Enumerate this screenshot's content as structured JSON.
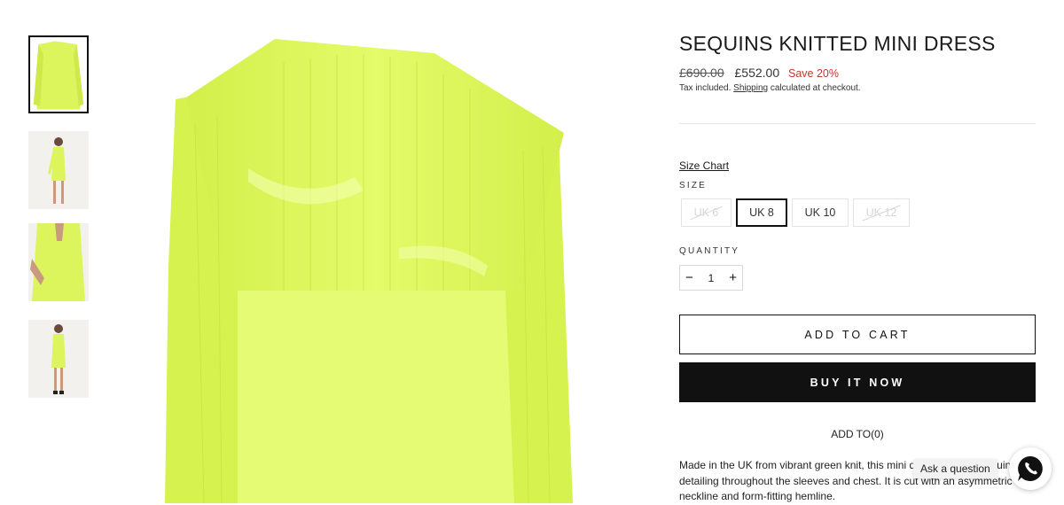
{
  "product": {
    "title": "SEQUINS KNITTED MINI DRESS",
    "price_original": "£690.00",
    "price_sale": "£552.00",
    "save_label": "Save 20%",
    "tax_prefix": "Tax included. ",
    "shipping_link": "Shipping",
    "tax_suffix": " calculated at checkout."
  },
  "size": {
    "chart_link": "Size Chart",
    "label": "SIZE",
    "options": [
      {
        "label": "UK 6",
        "state": "unavailable"
      },
      {
        "label": "UK 8",
        "state": "selected"
      },
      {
        "label": "UK 10",
        "state": "available"
      },
      {
        "label": "UK 12",
        "state": "unavailable"
      }
    ]
  },
  "quantity": {
    "label": "QUANTITY",
    "minus": "−",
    "value": "1",
    "plus": "+"
  },
  "actions": {
    "add_to_cart": "ADD TO CART",
    "buy_now": "BUY IT NOW",
    "add_to_wishlist": "ADD TO",
    "wishlist_count": "(0)"
  },
  "description": "Made in the UK from vibrant green knit, this mini dress features sequin detailing throughout the sleeves and chest. It is cut with an asymmetric neckline and form-fitting hemline.",
  "chat": {
    "ask_label": "Ask a question",
    "icon": "whatsapp-icon"
  },
  "gallery": {
    "thumbnails": [
      "thumb-front-dress",
      "thumb-model-front",
      "thumb-model-back",
      "thumb-model-side"
    ],
    "active_index": 0
  },
  "colors": {
    "dress": "#dcf55c",
    "dress_shadow": "#c4e23a",
    "text": "#1a1a1a",
    "sale": "#c0392b",
    "button_dark": "#111111"
  }
}
